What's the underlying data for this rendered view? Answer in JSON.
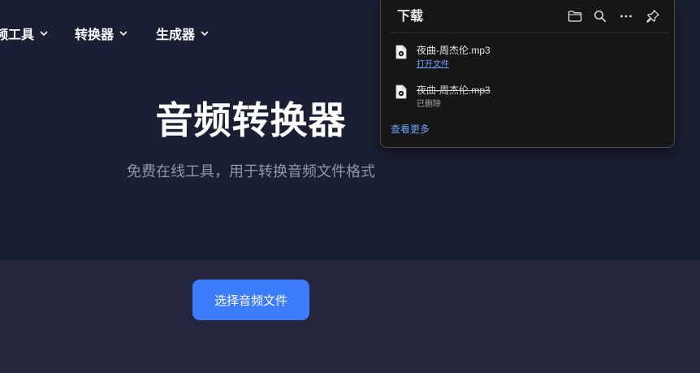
{
  "nav": {
    "items": [
      {
        "label": "频工具"
      },
      {
        "label": "转换器"
      },
      {
        "label": "生成器"
      }
    ]
  },
  "hero": {
    "title": "音频转换器",
    "subtitle": "免费在线工具，用于转换音频文件格式"
  },
  "upload": {
    "button_label": "选择音频文件"
  },
  "downloads": {
    "title": "下载",
    "items": [
      {
        "file_name": "夜曲-周杰伦.mp3",
        "action": "打开文件",
        "deleted": false
      },
      {
        "file_name": "夜曲-周杰伦.mp3",
        "action": "已删除",
        "deleted": true
      }
    ],
    "see_more": "查看更多"
  },
  "colors": {
    "page_bg": "#1b1f33",
    "lower_section_bg": "#24263d",
    "accent_blue": "#3d7cfb",
    "link_blue": "#6ea1ff",
    "panel_bg": "#161616"
  },
  "icons": [
    "chevron-down-icon",
    "folder-icon",
    "search-icon",
    "more-icon",
    "pin-icon",
    "audio-file-icon"
  ]
}
